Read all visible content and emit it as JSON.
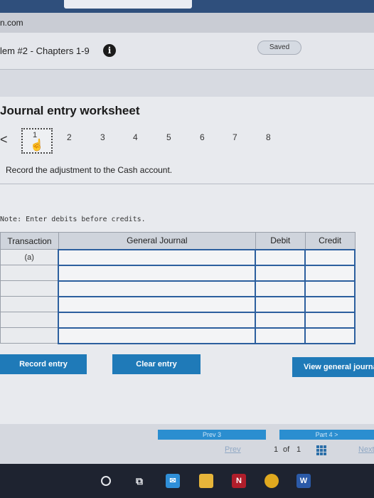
{
  "browser": {
    "url": "n.com"
  },
  "problem": {
    "title": "lem #2 - Chapters 1-9",
    "info_icon": "i",
    "saved_label": "Saved"
  },
  "worksheet": {
    "title": "Journal entry worksheet",
    "back_icon": "<",
    "steps": [
      "1",
      "2",
      "3",
      "4",
      "5",
      "6",
      "7",
      "8"
    ],
    "active_step": "1",
    "instruction": "Record the adjustment to the Cash account.",
    "note": "Note: Enter debits before credits."
  },
  "journal": {
    "headers": {
      "transaction": "Transaction",
      "general_journal": "General Journal",
      "debit": "Debit",
      "credit": "Credit"
    },
    "rows": [
      {
        "transaction": "(a)",
        "account": "",
        "debit": "",
        "credit": ""
      },
      {
        "transaction": "",
        "account": "",
        "debit": "",
        "credit": ""
      },
      {
        "transaction": "",
        "account": "",
        "debit": "",
        "credit": ""
      },
      {
        "transaction": "",
        "account": "",
        "debit": "",
        "credit": ""
      },
      {
        "transaction": "",
        "account": "",
        "debit": "",
        "credit": ""
      },
      {
        "transaction": "",
        "account": "",
        "debit": "",
        "credit": ""
      }
    ]
  },
  "buttons": {
    "record_entry": "Record entry",
    "clear_entry": "Clear entry",
    "view_general_journal": "View general journal"
  },
  "navigation": {
    "prev_part": "Prev 3",
    "next_part": "Part 4 >",
    "prev": "Prev",
    "page_current": "1",
    "page_of": "of",
    "page_total": "1",
    "next": "Next"
  },
  "taskbar": {
    "icons": [
      "search-icon",
      "task-view-icon",
      "mail-icon",
      "file-explorer-icon",
      "netflix-icon",
      "chrome-icon",
      "word-icon"
    ]
  },
  "colors": {
    "accent_blue": "#1f7ab8",
    "table_border_blue": "#2c5f9e",
    "header_band": "#2f4f7c"
  }
}
